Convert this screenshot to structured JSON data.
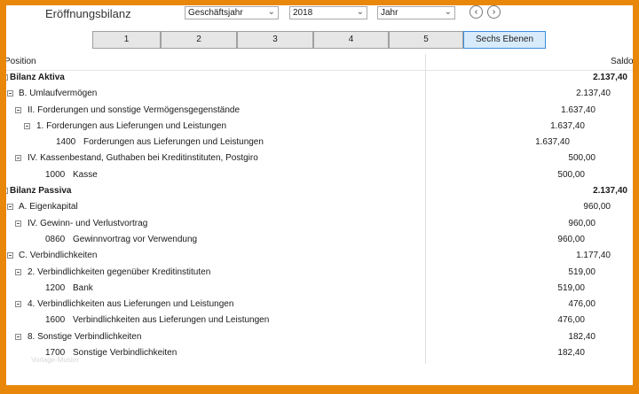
{
  "toolbar": {
    "title": "Eröffnungsbilanz",
    "period_type": "Geschäftsjahr",
    "year": "2018",
    "range": "Jahr",
    "prev_icon": "chevron-left-icon",
    "next_icon": "chevron-right-icon"
  },
  "levels": [
    "1",
    "2",
    "3",
    "4",
    "5",
    "Sechs Ebenen"
  ],
  "active_level": "Sechs Ebenen",
  "grid": {
    "col_position": "Position",
    "col_saldo": "Saldo"
  },
  "rows": [
    {
      "label": "Bilanz Aktiva",
      "amount": "2.137,40",
      "bold": true
    },
    {
      "label": "B. Umlaufvermögen",
      "amount": "2.137,40"
    },
    {
      "label": "II. Forderungen und sonstige Vermögensgegenstände",
      "amount": "1.637,40"
    },
    {
      "label": "1. Forderungen aus Lieferungen und Leistungen",
      "amount": "1.637,40"
    },
    {
      "account": "1400",
      "label": "Forderungen aus Lieferungen und Leistungen",
      "amount": "1.637,40"
    },
    {
      "label": "IV. Kassenbestand, Guthaben bei Kreditinstituten, Postgiro",
      "amount": "500,00"
    },
    {
      "account": "1000",
      "label": "Kasse",
      "amount": "500,00"
    },
    {
      "label": "Bilanz Passiva",
      "amount": "2.137,40",
      "bold": true
    },
    {
      "label": "A. Eigenkapital",
      "amount": "960,00"
    },
    {
      "label": "IV. Gewinn- und Verlustvortrag",
      "amount": "960,00"
    },
    {
      "account": "0860",
      "label": "Gewinnvortrag vor Verwendung",
      "amount": "960,00"
    },
    {
      "label": "C. Verbindlichkeiten",
      "amount": "1.177,40"
    },
    {
      "label": "2. Verbindlichkeiten gegenüber Kreditinstituten",
      "amount": "519,00"
    },
    {
      "account": "1200",
      "label": "Bank",
      "amount": "519,00"
    },
    {
      "label": "4. Verbindlichkeiten aus Lieferungen und Leistungen",
      "amount": "476,00"
    },
    {
      "account": "1600",
      "label": "Verbindlichkeiten aus Lieferungen und Leistungen",
      "amount": "476,00"
    },
    {
      "label": "8. Sonstige Verbindlichkeiten",
      "amount": "182,40"
    },
    {
      "account": "1700",
      "label": "Sonstige Verbindlichkeiten",
      "amount": "182,40"
    }
  ],
  "watermark": "Vorlage-Muster"
}
